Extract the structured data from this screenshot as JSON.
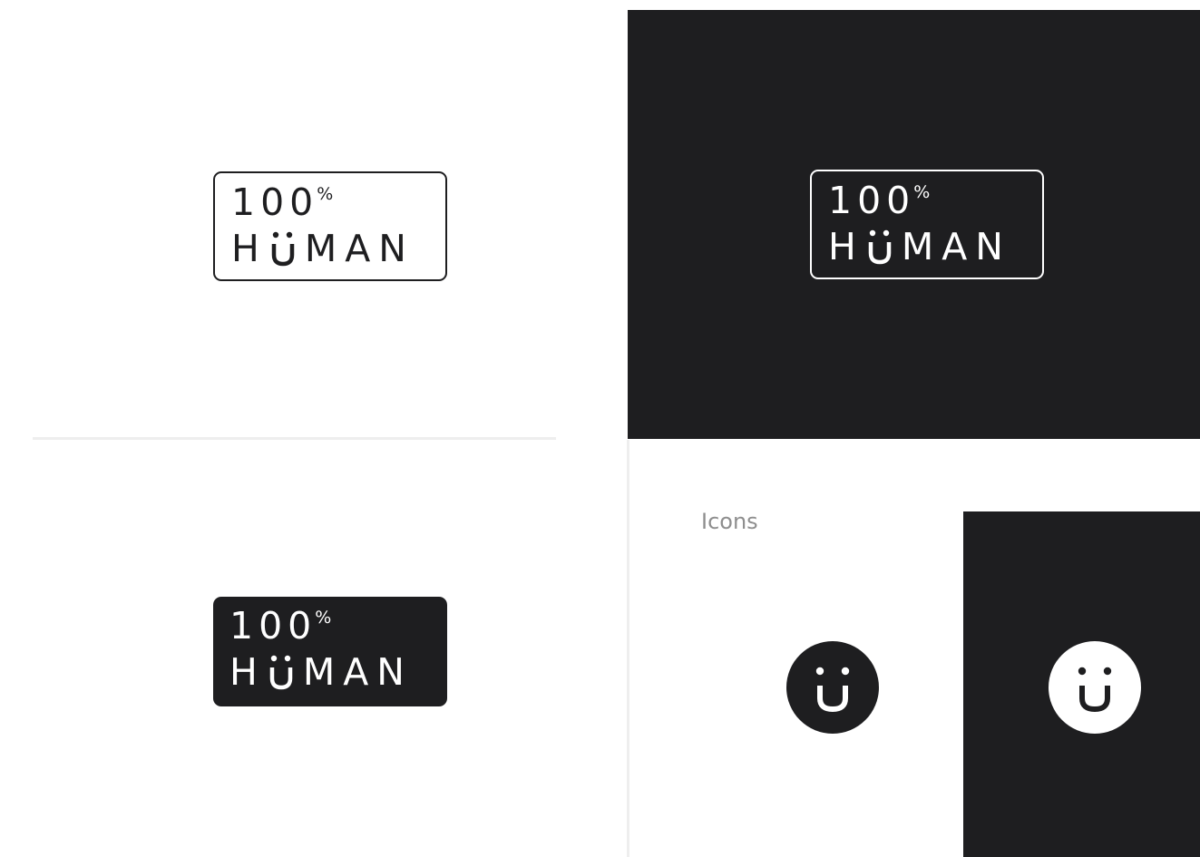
{
  "logo": {
    "line1_number": "100",
    "line1_percent": "%",
    "line2_prefix": "H",
    "line2_suffix": "MAN"
  },
  "icons_section": {
    "label": "Icons"
  },
  "colors": {
    "dark": "#1e1e20",
    "light": "#ffffff",
    "muted_text": "#8e8e8e",
    "divider": "#eeeeee"
  },
  "icons": [
    "smiley-u-icon-dark-on-light",
    "smiley-u-icon-light-on-dark"
  ]
}
